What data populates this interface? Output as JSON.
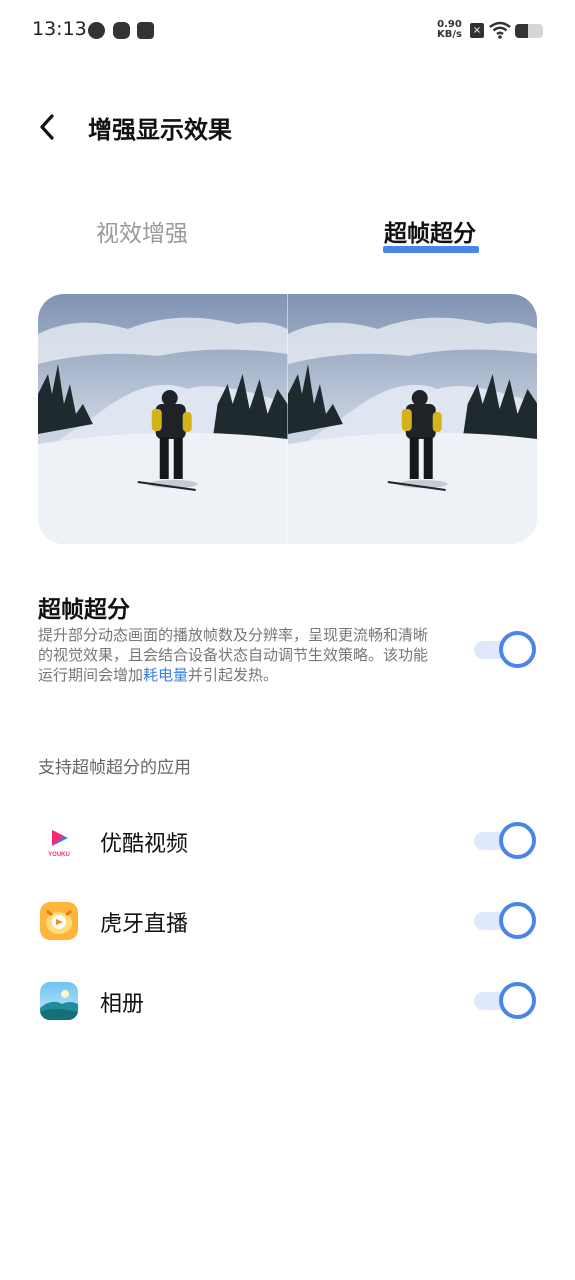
{
  "status_bar": {
    "time": "13:13",
    "net_speed_value": "0.90",
    "net_speed_unit": "KB/s",
    "battery_level": 0.45
  },
  "header": {
    "title": "增强显示效果"
  },
  "tabs": [
    {
      "label": "视效增强",
      "selected": false
    },
    {
      "label": "超帧超分",
      "selected": true
    }
  ],
  "feature": {
    "title": "超帧超分",
    "description_before": "提升部分动态画面的播放帧数及分辨率，呈现更流畅和清晰的视觉效果，且会结合设备状态自动调节生效策略。该功能运行期间会增加",
    "description_link": "耗电量",
    "description_after": "并引起发热。",
    "enabled": true
  },
  "apps_section": {
    "label": "支持超帧超分的应用",
    "apps": [
      {
        "name": "优酷视频",
        "icon": "youku-app-icon",
        "enabled": true
      },
      {
        "name": "虎牙直播",
        "icon": "huya-app-icon",
        "enabled": true
      },
      {
        "name": "相册",
        "icon": "gallery-app-icon",
        "enabled": true
      }
    ]
  },
  "colors": {
    "accent": "#4a86e8",
    "link": "#3a7fe0"
  }
}
